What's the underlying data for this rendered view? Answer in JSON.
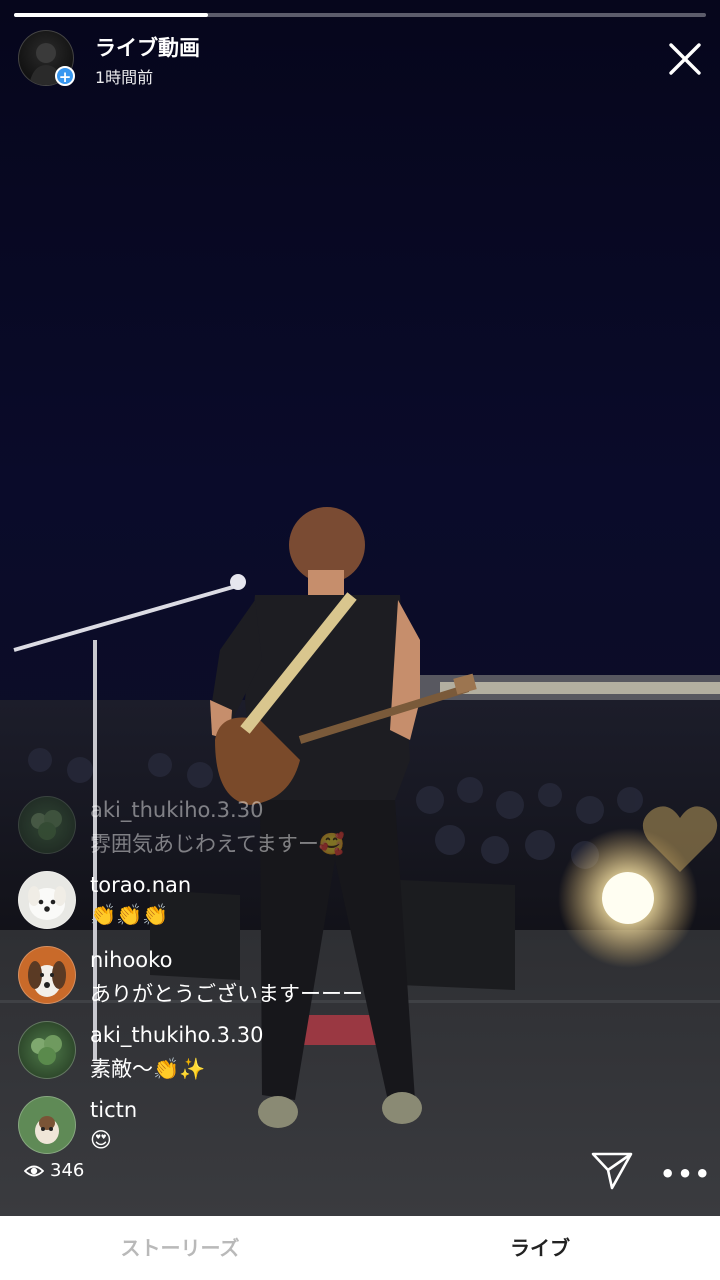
{
  "story": {
    "title": "ライブ動画",
    "time_ago": "1時間前",
    "progress": 0.28
  },
  "comments": [
    {
      "user": "aki_thukiho.3.30",
      "text": "雰囲気あじわえてますー🥰",
      "faded": true
    },
    {
      "user": "torao.nan",
      "text": "👏👏👏",
      "faded": false
    },
    {
      "user": "nihooko",
      "text": "ありがとうございますーーー",
      "faded": false
    },
    {
      "user": "aki_thukiho.3.30",
      "text": "素敵〜👏✨",
      "faded": false
    },
    {
      "user": "tictn",
      "text": "😍",
      "faded": false
    }
  ],
  "viewers": {
    "count": "346",
    "icon": "eye-icon"
  },
  "actions": {
    "send_icon": "send-icon",
    "more_label": "•••"
  },
  "bottom_tabs": [
    {
      "label": "ストーリーズ",
      "active": false
    },
    {
      "label": "ライブ",
      "active": true
    }
  ],
  "colors": {
    "badge": "#3897f0",
    "heart": "#b89a5a",
    "bar_bg": "#ffffff"
  }
}
